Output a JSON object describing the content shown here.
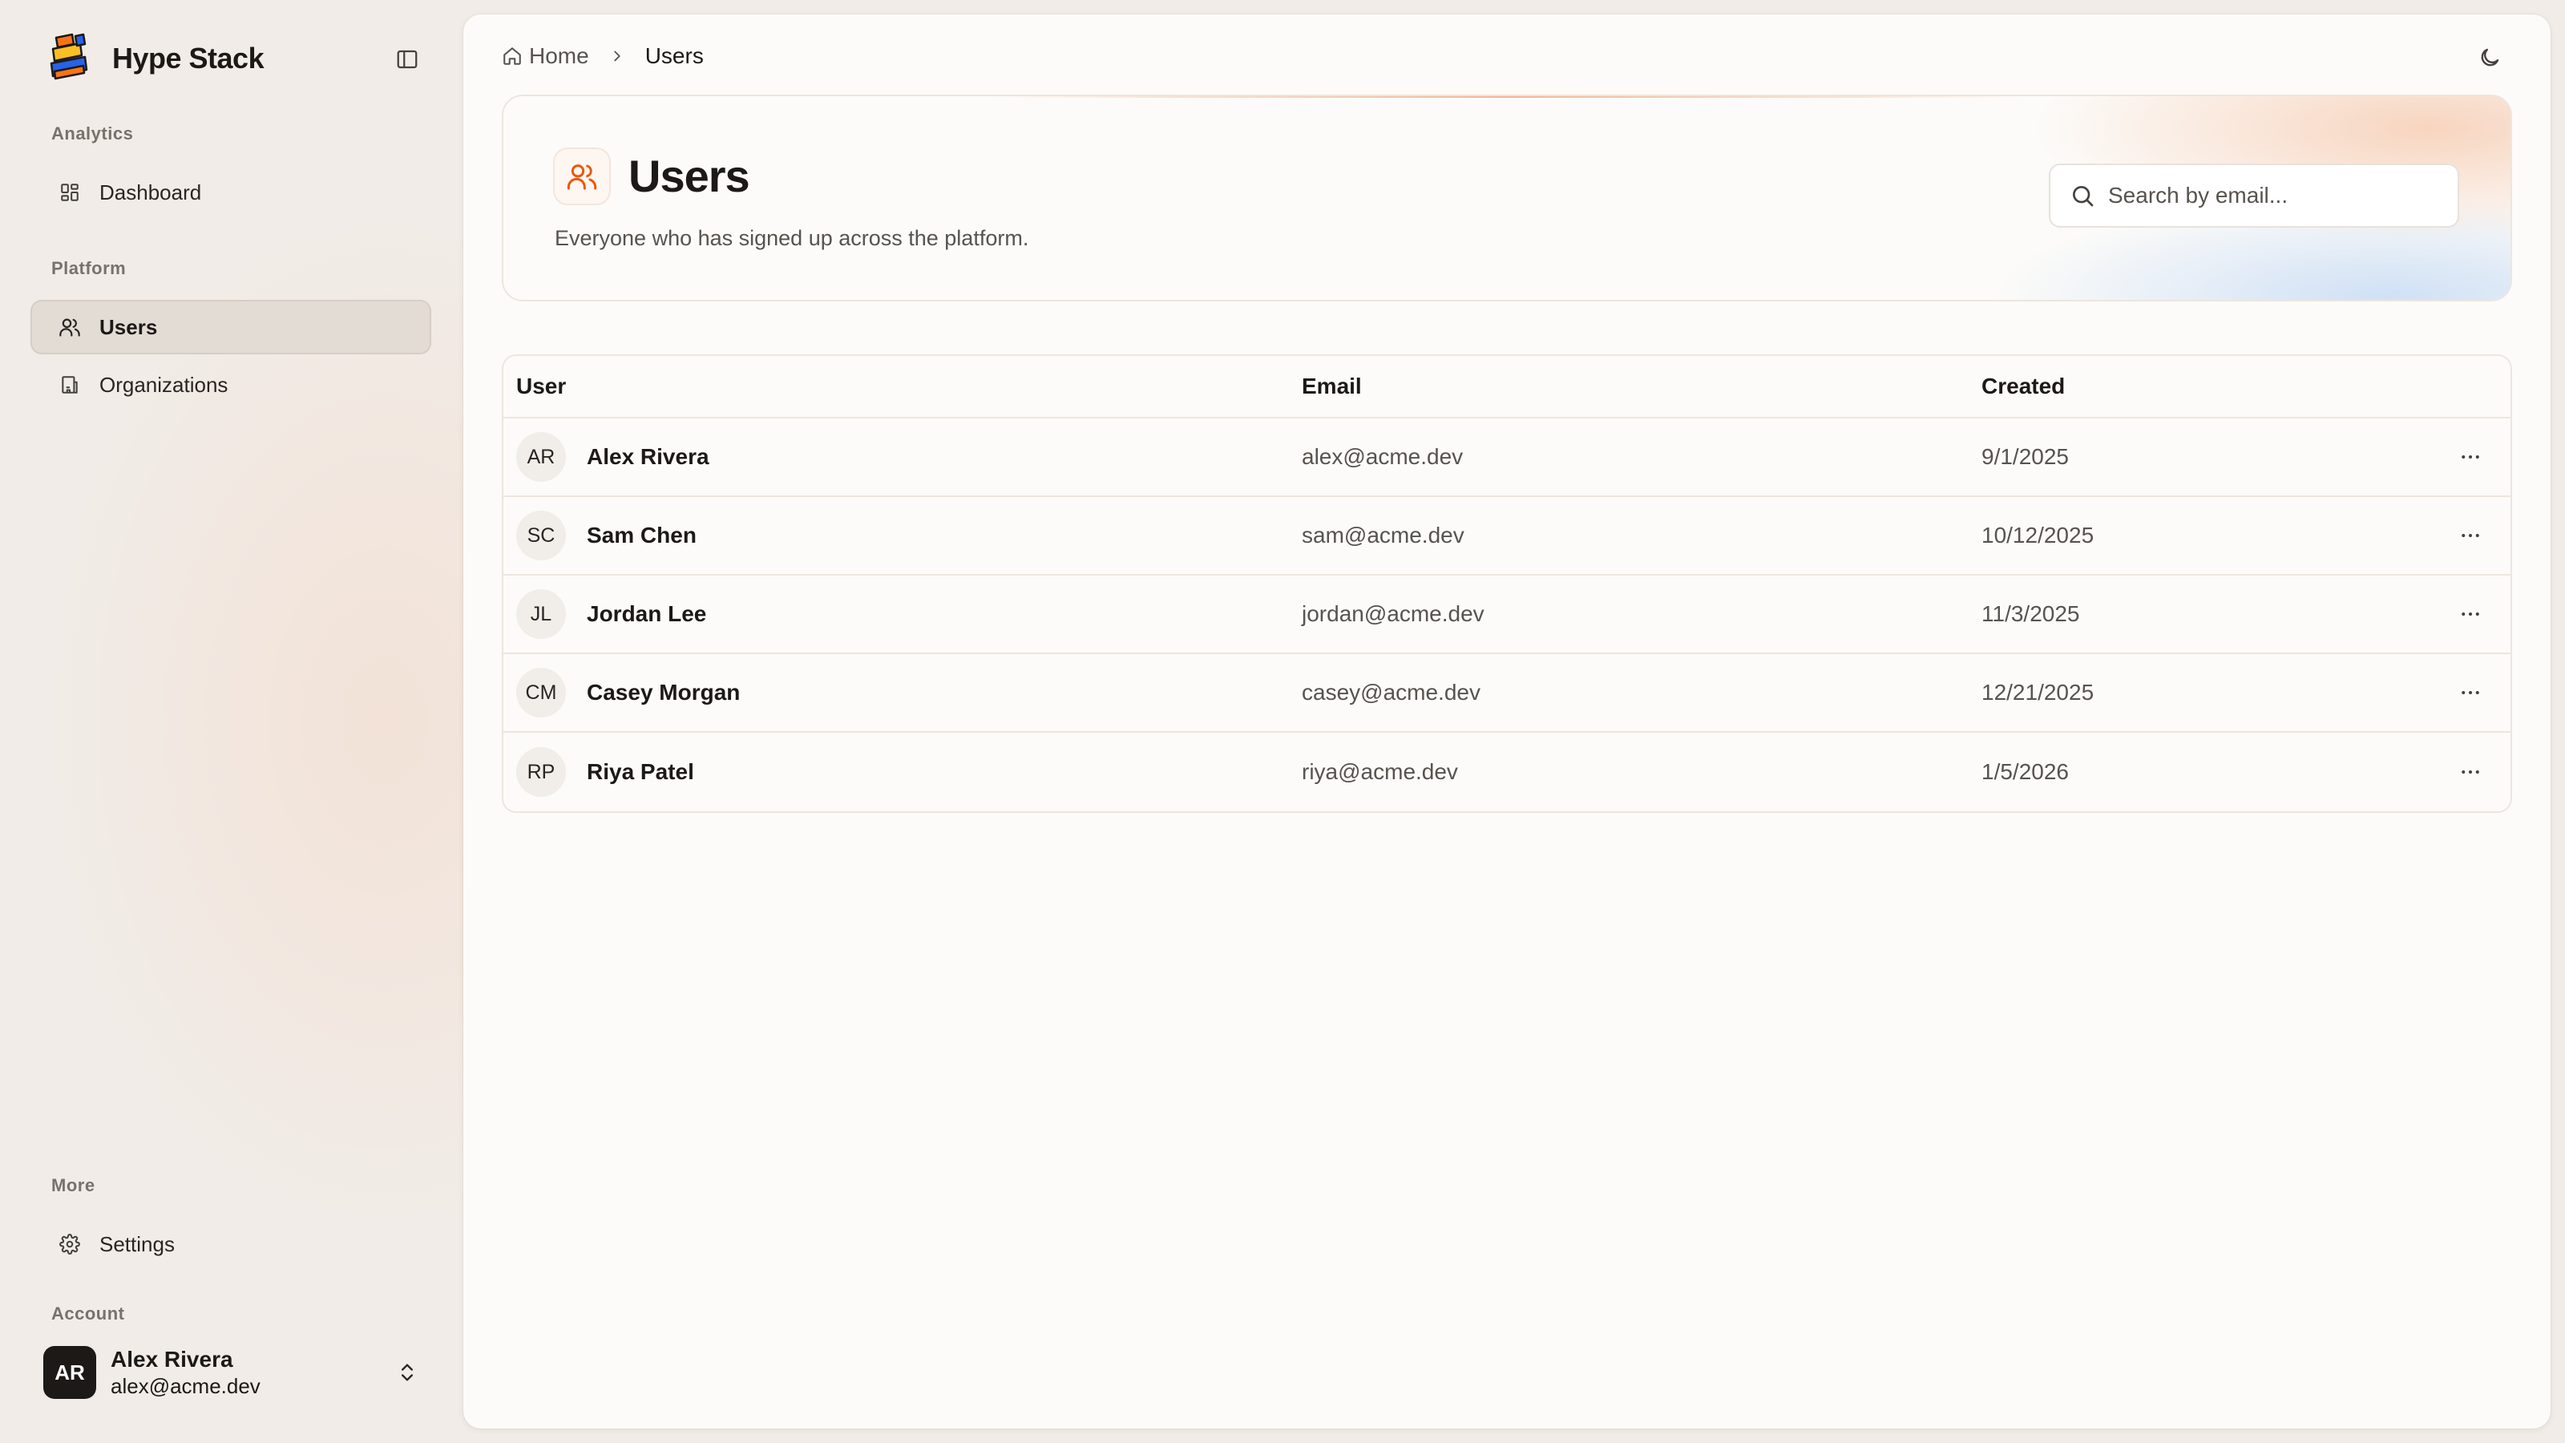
{
  "app": {
    "name": "Hype Stack",
    "logo_colors": [
      "#2563eb",
      "#f97316",
      "#fbbf24",
      "#1c1917"
    ]
  },
  "sidebar": {
    "sections": [
      {
        "label": "Analytics",
        "items": [
          {
            "label": "Dashboard",
            "icon": "dashboard-grid-icon",
            "active": false
          }
        ]
      },
      {
        "label": "Platform",
        "items": [
          {
            "label": "Users",
            "icon": "users-icon",
            "active": true
          },
          {
            "label": "Organizations",
            "icon": "building-icon",
            "active": false
          }
        ]
      },
      {
        "label": "More",
        "items": [
          {
            "label": "Settings",
            "icon": "gear-icon",
            "active": false
          }
        ]
      },
      {
        "label": "Account"
      }
    ],
    "account": {
      "initials": "AR",
      "name": "Alex Rivera",
      "email": "alex@acme.dev"
    }
  },
  "breadcrumb": {
    "home": "Home",
    "current": "Users"
  },
  "page": {
    "title": "Users",
    "subtitle": "Everyone who has signed up across the platform.",
    "accent": "#ea580c",
    "search": {
      "placeholder": "Search by email...",
      "value": ""
    }
  },
  "table": {
    "columns": [
      "User",
      "Email",
      "Created"
    ],
    "rows": [
      {
        "initials": "AR",
        "name": "Alex Rivera",
        "email": "alex@acme.dev",
        "created": "9/1/2025"
      },
      {
        "initials": "SC",
        "name": "Sam Chen",
        "email": "sam@acme.dev",
        "created": "10/12/2025"
      },
      {
        "initials": "JL",
        "name": "Jordan Lee",
        "email": "jordan@acme.dev",
        "created": "11/3/2025"
      },
      {
        "initials": "CM",
        "name": "Casey Morgan",
        "email": "casey@acme.dev",
        "created": "12/21/2025"
      },
      {
        "initials": "RP",
        "name": "Riya Patel",
        "email": "riya@acme.dev",
        "created": "1/5/2026"
      }
    ]
  }
}
